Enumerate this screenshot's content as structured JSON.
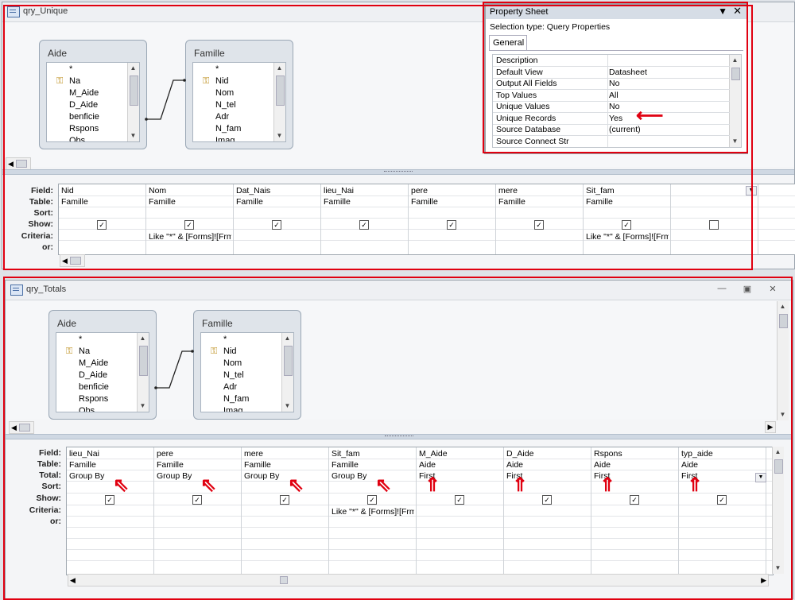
{
  "top_window": {
    "title": "qry_Unique",
    "tables": [
      {
        "name": "Aide",
        "fields": [
          "*",
          "Na",
          "M_Aide",
          "D_Aide",
          "benficie",
          "Rspons",
          "Obs"
        ]
      },
      {
        "name": "Famille",
        "fields": [
          "*",
          "Nid",
          "Nom",
          "N_tel",
          "Adr",
          "N_fam",
          "Imag"
        ]
      }
    ],
    "grid_row_labels": [
      "Field:",
      "Table:",
      "Sort:",
      "Show:",
      "Criteria:",
      "or:"
    ],
    "columns": [
      {
        "field": "Nid",
        "table": "Famille",
        "show": true,
        "criteria": ""
      },
      {
        "field": "Nom",
        "table": "Famille",
        "show": true,
        "criteria": "Like \"*\" & [Forms]![Frm"
      },
      {
        "field": "Dat_Nais",
        "table": "Famille",
        "show": true,
        "criteria": ""
      },
      {
        "field": "lieu_Nai",
        "table": "Famille",
        "show": true,
        "criteria": ""
      },
      {
        "field": "pere",
        "table": "Famille",
        "show": true,
        "criteria": ""
      },
      {
        "field": "mere",
        "table": "Famille",
        "show": true,
        "criteria": ""
      },
      {
        "field": "Sit_fam",
        "table": "Famille",
        "show": true,
        "criteria": "Like \"*\" & [Forms]![Frm"
      },
      {
        "field": "",
        "table": "",
        "show": false,
        "criteria": ""
      }
    ]
  },
  "property_sheet": {
    "title": "Property Sheet",
    "selection_type": "Selection type:  Query Properties",
    "tab": "General",
    "rows": [
      {
        "name": "Description",
        "value": ""
      },
      {
        "name": "Default View",
        "value": "Datasheet"
      },
      {
        "name": "Output All Fields",
        "value": "No"
      },
      {
        "name": "Top Values",
        "value": "All"
      },
      {
        "name": "Unique Values",
        "value": "No"
      },
      {
        "name": "Unique Records",
        "value": "Yes"
      },
      {
        "name": "Source Database",
        "value": "(current)"
      },
      {
        "name": "Source Connect Str",
        "value": ""
      }
    ]
  },
  "bottom_window": {
    "title": "qry_Totals",
    "tables": [
      {
        "name": "Aide",
        "fields": [
          "*",
          "Na",
          "M_Aide",
          "D_Aide",
          "benficie",
          "Rspons",
          "Obs"
        ]
      },
      {
        "name": "Famille",
        "fields": [
          "*",
          "Nid",
          "Nom",
          "N_tel",
          "Adr",
          "N_fam",
          "Imag"
        ]
      }
    ],
    "grid_row_labels": [
      "Field:",
      "Table:",
      "Total:",
      "Sort:",
      "Show:",
      "Criteria:",
      "or:"
    ],
    "columns": [
      {
        "field": "lieu_Nai",
        "table": "Famille",
        "total": "Group By",
        "show": true,
        "criteria": ""
      },
      {
        "field": "pere",
        "table": "Famille",
        "total": "Group By",
        "show": true,
        "criteria": ""
      },
      {
        "field": "mere",
        "table": "Famille",
        "total": "Group By",
        "show": true,
        "criteria": ""
      },
      {
        "field": "Sit_fam",
        "table": "Famille",
        "total": "Group By",
        "show": true,
        "criteria": "Like \"*\" & [Forms]![Frm"
      },
      {
        "field": "M_Aide",
        "table": "Aide",
        "total": "First",
        "show": true,
        "criteria": ""
      },
      {
        "field": "D_Aide",
        "table": "Aide",
        "total": "First",
        "show": true,
        "criteria": ""
      },
      {
        "field": "Rspons",
        "table": "Aide",
        "total": "First",
        "show": true,
        "criteria": ""
      },
      {
        "field": "typ_aide",
        "table": "Aide",
        "total": "First",
        "show": true,
        "criteria": ""
      }
    ]
  },
  "colors": {
    "annotation": "#e00010"
  },
  "icons": [
    "query-icon",
    "key-icon",
    "scroll-up-icon",
    "scroll-down-icon",
    "dropdown-icon",
    "close-icon",
    "minimize-icon",
    "restore-icon"
  ]
}
